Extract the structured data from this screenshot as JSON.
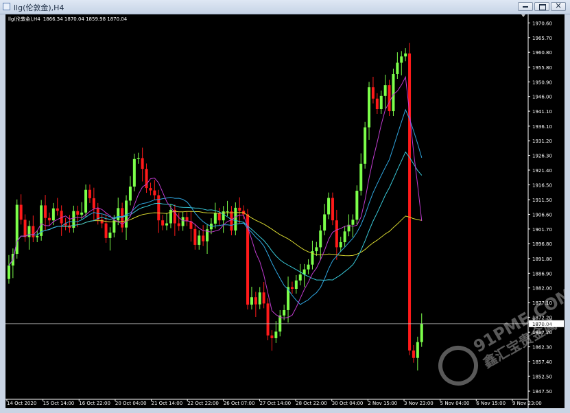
{
  "window": {
    "title": "llg(伦敦金),H4",
    "buttons": [
      "minimize",
      "maximize",
      "close"
    ]
  },
  "chart_header": {
    "symbol_label": "llg(伦敦金),H4",
    "ohlc": "1866.34 1870.04 1859.98 1870.04"
  },
  "price_axis": {
    "ticks": [
      "1970.60",
      "1965.70",
      "1960.80",
      "1955.80",
      "1950.90",
      "1946.00",
      "1941.10",
      "1936.10",
      "1931.20",
      "1926.30",
      "1921.40",
      "1916.50",
      "1911.50",
      "1906.60",
      "1901.70",
      "1896.80",
      "1891.80",
      "1886.90",
      "1882.00",
      "1877.10",
      "1872.20",
      "1867.20",
      "1862.30",
      "1857.40",
      "1852.50",
      "1847.50"
    ],
    "current_price": "1870.04"
  },
  "time_axis": {
    "labels": [
      "14 Oct 2020",
      "15 Oct 14:00",
      "16 Oct 22:00",
      "20 Oct 04:00",
      "21 Oct 14:00",
      "22 Oct 22:00",
      "26 Oct 07:00",
      "27 Oct 14:00",
      "28 Oct 22:00",
      "30 Oct 04:00",
      "2 Nov 15:00",
      "3 Nov 23:00",
      "5 Nov 04:00",
      "6 Nov 15:00",
      "9 Nov 23:00"
    ]
  },
  "watermark": {
    "line1": "91PME.COM",
    "line2": "鑫汇宝贵金属"
  },
  "colors": {
    "background": "#000000",
    "bull": "#7cff4a",
    "bear": "#ff1a1a",
    "ma_fast": "#c03bd0",
    "ma_mid": "#2fa6e0",
    "ma_slow_cyan": "#38c8d8",
    "ma_slow": "#d8d830",
    "axis": "#ffffff"
  },
  "chart_data": {
    "type": "candlestick",
    "title": "llg(伦敦金),H4",
    "ylim": [
      1845,
      1973
    ],
    "close": [
      1889.5,
      1893.4,
      1909.8,
      1904.8,
      1899.0,
      1902.7,
      1898.9,
      1899.4,
      1909.6,
      1905.4,
      1904.6,
      1908.6,
      1907.8,
      1903.6,
      1902.9,
      1902.1,
      1907.7,
      1906.5,
      1907.2,
      1914.8,
      1912.0,
      1908.6,
      1904.8,
      1903.6,
      1898.7,
      1900.5,
      1904.6,
      1908.7,
      1902.2,
      1911.2,
      1915.9,
      1925.1,
      1925.4,
      1921.8,
      1915.4,
      1914.6,
      1913.0,
      1904.6,
      1902.9,
      1903.6,
      1908.1,
      1903.6,
      1902.7,
      1905.7,
      1904.3,
      1901.7,
      1896.4,
      1899.5,
      1897.6,
      1901.6,
      1903.5,
      1907.0,
      1904.6,
      1907.6,
      1907.6,
      1901.2,
      1908.8,
      1907.8,
      1906.6,
      1876.4,
      1878.9,
      1876.5,
      1880.5,
      1876.8,
      1866.1,
      1865.2,
      1867.4,
      1872.8,
      1874.6,
      1882.3,
      1881.7,
      1884.5,
      1886.5,
      1888.2,
      1889.8,
      1894.3,
      1895.6,
      1901.2,
      1906.6,
      1912.1,
      1904.6,
      1895.6,
      1897.3,
      1900.9,
      1903.1,
      1904.8,
      1914.5,
      1923.5,
      1935.7,
      1949.1,
      1945.3,
      1941.8,
      1946.2,
      1949.8,
      1941.1,
      1953.5,
      1957.3,
      1959.4,
      1960.4,
      1861.1,
      1858.6,
      1863.9,
      1870.0
    ],
    "open": [
      1885.0,
      1889.5,
      1893.4,
      1909.8,
      1904.8,
      1899.0,
      1902.7,
      1898.9,
      1899.4,
      1909.6,
      1905.4,
      1904.6,
      1908.6,
      1907.8,
      1903.6,
      1902.9,
      1902.1,
      1907.7,
      1906.5,
      1907.2,
      1914.8,
      1912.0,
      1908.6,
      1904.8,
      1903.6,
      1898.7,
      1900.5,
      1904.6,
      1908.7,
      1902.2,
      1911.2,
      1915.9,
      1925.1,
      1925.4,
      1921.8,
      1915.4,
      1914.6,
      1913.0,
      1904.6,
      1902.9,
      1903.6,
      1908.1,
      1903.6,
      1902.7,
      1905.7,
      1904.3,
      1901.7,
      1896.4,
      1899.5,
      1897.6,
      1901.6,
      1903.5,
      1907.0,
      1904.6,
      1907.6,
      1907.6,
      1901.2,
      1908.8,
      1907.8,
      1906.6,
      1876.4,
      1878.9,
      1876.5,
      1880.5,
      1876.8,
      1866.1,
      1865.2,
      1867.4,
      1872.8,
      1874.6,
      1882.3,
      1881.7,
      1884.5,
      1886.5,
      1888.2,
      1889.8,
      1894.3,
      1895.6,
      1901.2,
      1906.6,
      1912.1,
      1904.6,
      1895.6,
      1897.3,
      1900.9,
      1903.1,
      1904.8,
      1914.5,
      1923.5,
      1935.7,
      1949.1,
      1945.3,
      1941.8,
      1946.2,
      1949.8,
      1941.1,
      1953.5,
      1957.3,
      1959.4,
      1960.4,
      1861.1,
      1858.6,
      1863.9
    ],
    "ma_slow_last": 1903.7
  }
}
